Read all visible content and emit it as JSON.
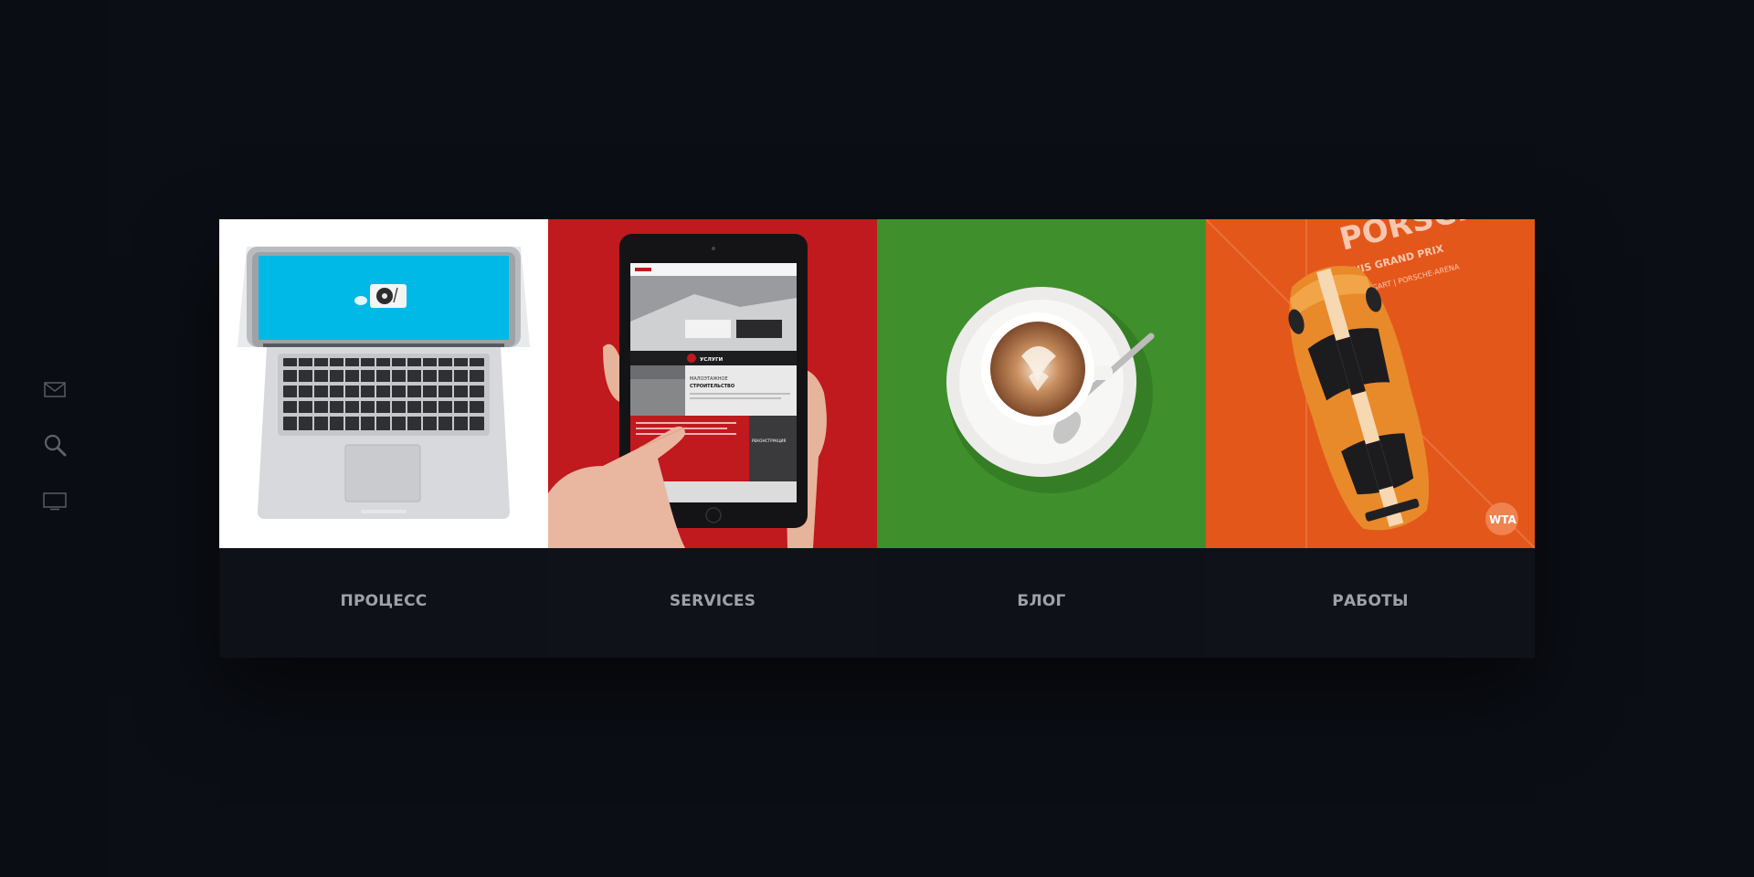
{
  "sidebar": {
    "icons": [
      {
        "name": "mail-icon"
      },
      {
        "name": "search-icon"
      },
      {
        "name": "monitor-icon"
      }
    ]
  },
  "cards": [
    {
      "label": "ПРОЦЕСС",
      "image": "laptop-image",
      "background": "#ffffff"
    },
    {
      "label": "SERVICES",
      "image": "tablet-image",
      "background": "#c0191e"
    },
    {
      "label": "БЛОГ",
      "image": "coffee-image",
      "background": "#3f902c"
    },
    {
      "label": "РАБОТЫ",
      "image": "sports-car-image",
      "background": "#e4571a"
    }
  ],
  "artwork": {
    "tablet_menu": "УСЛУГИ",
    "tablet_heading_1": "МАЛОЭТАЖНОЕ",
    "tablet_heading_2": "СТРОИТЕЛЬСТВО",
    "tablet_panel": "РЕКОНСТРУКЦИЯ",
    "poster_line_1": "PORSCHE",
    "poster_line_2": "TENNIS GRAND PRIX",
    "poster_line_3": "STUTTGART | PORSCHE-ARENA",
    "poster_badge": "WTA"
  },
  "colors": {
    "page_background": "#0b0e15",
    "caption_background": "#0f1219",
    "caption_text": "#9ea1a8"
  }
}
